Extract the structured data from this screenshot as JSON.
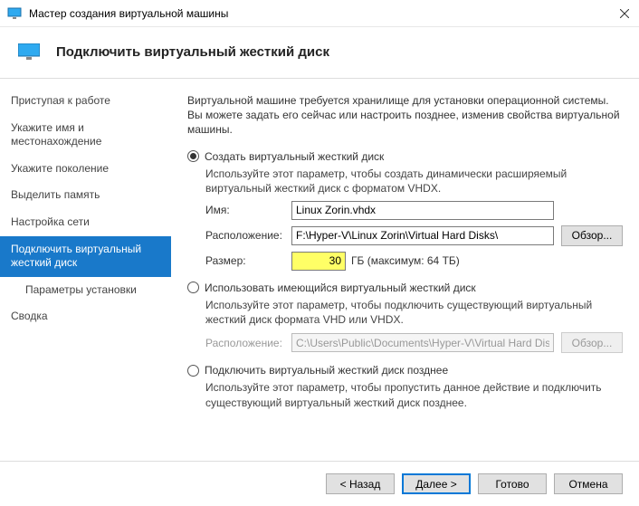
{
  "window": {
    "title": "Мастер создания виртуальной машины"
  },
  "header": {
    "title": "Подключить виртуальный жесткий диск"
  },
  "nav": {
    "items": [
      {
        "label": "Приступая к работе"
      },
      {
        "label": "Укажите имя и местонахождение"
      },
      {
        "label": "Укажите поколение"
      },
      {
        "label": "Выделить память"
      },
      {
        "label": "Настройка сети"
      },
      {
        "label": "Подключить виртуальный жесткий диск"
      },
      {
        "label": "Параметры установки"
      },
      {
        "label": "Сводка"
      }
    ]
  },
  "main": {
    "intro": "Виртуальной машине требуется хранилище для установки операционной системы. Вы можете задать его сейчас или настроить позднее, изменив свойства виртуальной машины.",
    "opt_create": {
      "label": "Создать виртуальный жесткий диск",
      "desc": "Используйте этот параметр, чтобы создать динамически расширяемый виртуальный жесткий диск с форматом VHDX.",
      "name_label": "Имя:",
      "name_value": "Linux Zorin.vhdx",
      "loc_label": "Расположение:",
      "loc_value": "F:\\Hyper-V\\Linux Zorin\\Virtual Hard Disks\\",
      "browse": "Обзор...",
      "size_label": "Размер:",
      "size_value": "30",
      "size_unit": "ГБ (максимум: 64 ТБ)"
    },
    "opt_existing": {
      "label": "Использовать имеющийся виртуальный жесткий диск",
      "desc": "Используйте этот параметр, чтобы подключить существующий виртуальный жесткий диск формата VHD или VHDX.",
      "loc_label": "Расположение:",
      "loc_value": "C:\\Users\\Public\\Documents\\Hyper-V\\Virtual Hard Disks\\",
      "browse": "Обзор..."
    },
    "opt_later": {
      "label": "Подключить виртуальный жесткий диск позднее",
      "desc": "Используйте этот параметр, чтобы пропустить данное действие и подключить существующий виртуальный жесткий диск позднее."
    }
  },
  "footer": {
    "back": "< Назад",
    "next": "Далее >",
    "finish": "Готово",
    "cancel": "Отмена"
  }
}
